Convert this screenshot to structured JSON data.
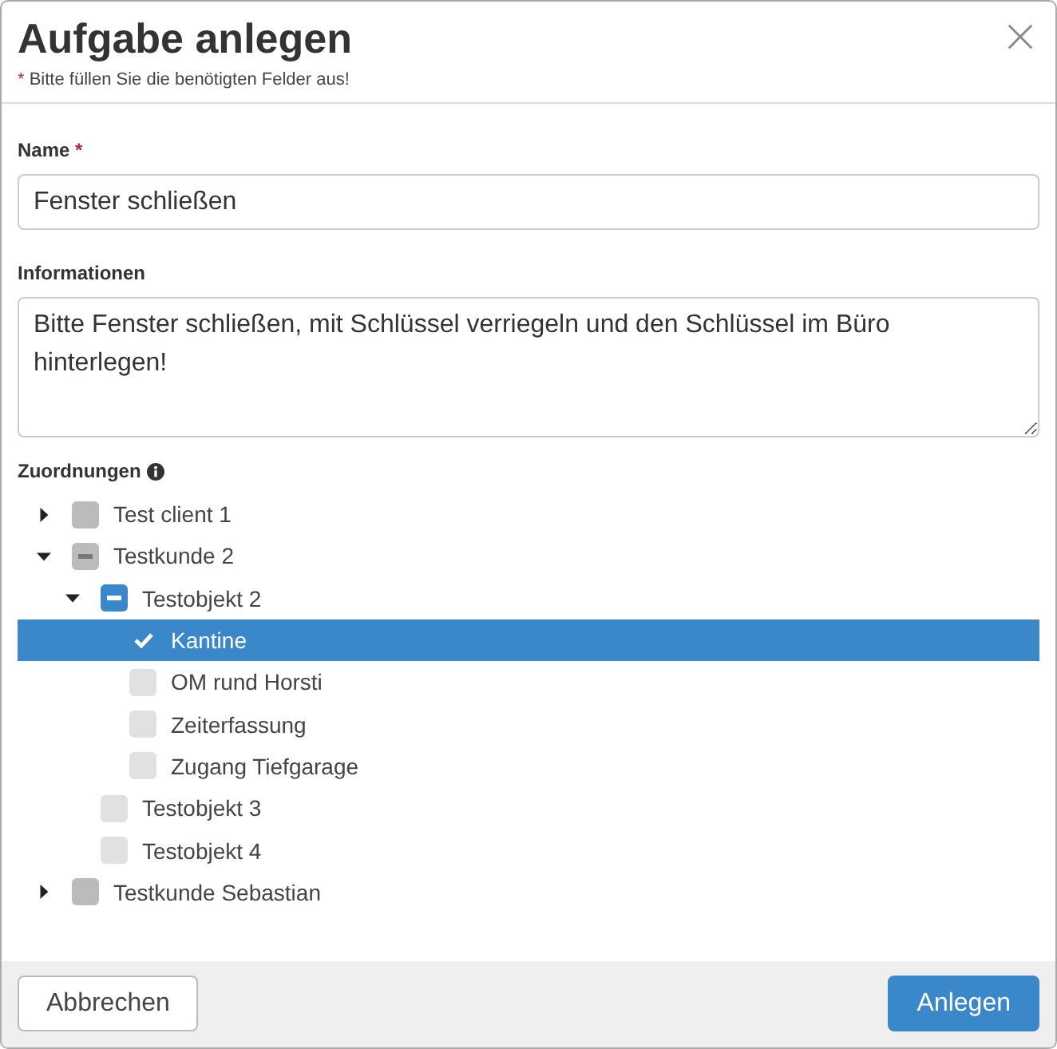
{
  "dialog": {
    "title": "Aufgabe anlegen",
    "required_hint_mark": "*",
    "required_hint": "Bitte füllen Sie die benötigten Felder aus!"
  },
  "fields": [
    {
      "kind": "input",
      "label": "Name",
      "required_mark": "*",
      "value": "Fenster schließen"
    },
    {
      "kind": "textarea",
      "label": "Informationen",
      "value": "Bitte Fenster schließen, mit Schlüssel verriegeln und den Schlüssel im Büro hinterlegen!"
    }
  ],
  "assignments": {
    "label": "Zuordnungen",
    "tree": [
      {
        "label": "Test client 1",
        "expanded": false,
        "checked": false,
        "partial": false,
        "selected": false
      },
      {
        "label": "Testkunde 2",
        "expanded": true,
        "checked": false,
        "partial": true,
        "selected": false,
        "children": [
          {
            "label": "Testobjekt 2",
            "expanded": true,
            "checked": false,
            "partial": true,
            "selected": false,
            "children": [
              {
                "label": "Kantine",
                "checked": true,
                "partial": false,
                "selected": true
              },
              {
                "label": "OM rund Horsti",
                "checked": false,
                "partial": false,
                "selected": false
              },
              {
                "label": "Zeiterfassung",
                "checked": false,
                "partial": false,
                "selected": false
              },
              {
                "label": "Zugang Tiefgarage",
                "checked": false,
                "partial": false,
                "selected": false
              }
            ]
          },
          {
            "label": "Testobjekt 3",
            "checked": false,
            "partial": false,
            "selected": false
          },
          {
            "label": "Testobjekt 4",
            "checked": false,
            "partial": false,
            "selected": false
          }
        ]
      },
      {
        "label": "Testkunde Sebastian",
        "expanded": false,
        "checked": false,
        "partial": false,
        "selected": false
      }
    ]
  },
  "buttons": [
    {
      "kind": "secondary",
      "label": "Abbrechen"
    },
    {
      "kind": "primary",
      "label": "Anlegen"
    }
  ]
}
